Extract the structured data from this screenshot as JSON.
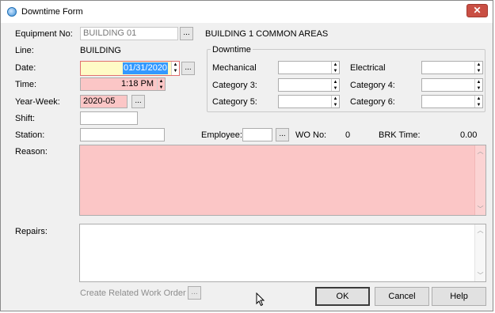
{
  "window": {
    "title": "Downtime Form",
    "close_glyph": "✕"
  },
  "equipment": {
    "label": "Equipment No:",
    "value": "BUILDING 01",
    "description": "BUILDING 1 COMMON AREAS"
  },
  "line": {
    "label": "Line:",
    "value": "BUILDING"
  },
  "date": {
    "label": "Date:",
    "value": "01/31/2020"
  },
  "time": {
    "label": "Time:",
    "value": "1:18 PM"
  },
  "year_week": {
    "label": "Year-Week:",
    "value": "2020-05"
  },
  "shift": {
    "label": "Shift:",
    "value": ""
  },
  "station": {
    "label": "Station:",
    "value": ""
  },
  "employee": {
    "label": "Employee:",
    "value": ""
  },
  "wo_no": {
    "label": "WO No:",
    "value": "0"
  },
  "brk_time": {
    "label": "BRK Time:",
    "value": "0.00"
  },
  "downtime": {
    "title": "Downtime",
    "mechanical": {
      "label": "Mechanical",
      "value": ""
    },
    "electrical": {
      "label": "Electrical",
      "value": ""
    },
    "category3": {
      "label": "Category 3:",
      "value": ""
    },
    "category4": {
      "label": "Category 4:",
      "value": ""
    },
    "category5": {
      "label": "Category 5:",
      "value": ""
    },
    "category6": {
      "label": "Category 6:",
      "value": ""
    }
  },
  "reason": {
    "label": "Reason:",
    "value": ""
  },
  "repairs": {
    "label": "Repairs:",
    "value": ""
  },
  "buttons": {
    "dots": "...",
    "create_related_wo": "Create Related Work Order",
    "ok": "OK",
    "cancel": "Cancel",
    "help": "Help"
  },
  "glyphs": {
    "up": "▲",
    "down": "▼",
    "scroll_up": "︿",
    "scroll_down": "﹀"
  },
  "colors": {
    "required_bg": "#fbc6c6",
    "date_highlight": "#fffbc6",
    "selection": "#3399ff"
  }
}
